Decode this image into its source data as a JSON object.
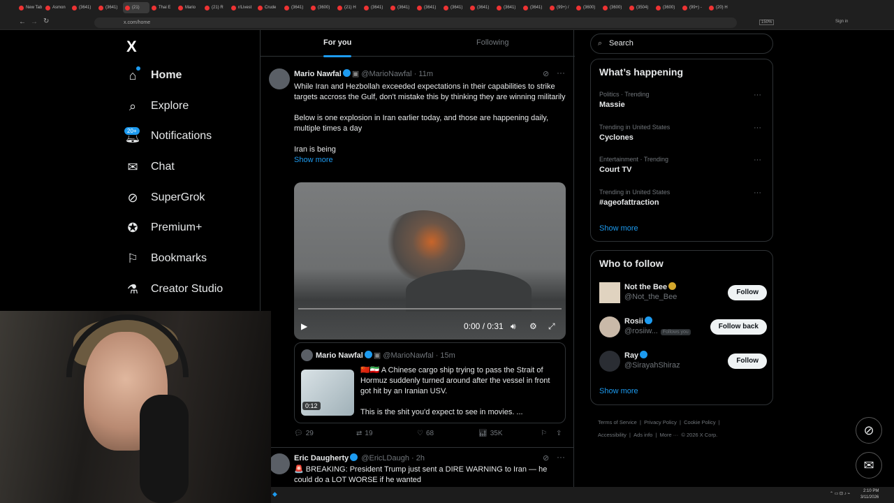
{
  "browser": {
    "tabs": [
      "New Tab",
      "Asmon",
      "(3641)",
      "(3641)",
      "(21)",
      "Thai E",
      "Mario",
      "(21) R",
      "r/Livest",
      "Crude",
      "(3641)",
      "(3600)",
      "(21) H",
      "(3641)",
      "(3641)",
      "(3641)",
      "(3641)",
      "(3641)",
      "(3641)",
      "(3641)",
      "(99+) /",
      "(3600)",
      "(3600)",
      "(3504)",
      "(3600)",
      "(99+) -",
      "(20) H"
    ],
    "url": "x.com/home",
    "zoom": "150%",
    "sign_in": "Sign in"
  },
  "nav": {
    "logo": "X",
    "notif_badge": "20+",
    "items": [
      {
        "label": "Home",
        "icon": "home-icon"
      },
      {
        "label": "Explore",
        "icon": "search-icon"
      },
      {
        "label": "Notifications",
        "icon": "bell-icon"
      },
      {
        "label": "Chat",
        "icon": "mail-icon"
      },
      {
        "label": "SuperGrok",
        "icon": "grok-icon"
      },
      {
        "label": "Premium+",
        "icon": "premium-icon"
      },
      {
        "label": "Bookmarks",
        "icon": "bookmark-icon"
      },
      {
        "label": "Creator Studio",
        "icon": "flask-icon"
      }
    ]
  },
  "feed": {
    "tabs": [
      "For you",
      "Following"
    ],
    "tweet1": {
      "name": "Mario Nawfal",
      "handle": "@MarioNawfal",
      "time": "· 11m",
      "text1": "While Iran and Hezbollah exceeded expectations in their capabilities to strike targets accross the Gulf, don't mistake this by thinking they are winning militarily",
      "text2": "Below is one explosion in Iran earlier today, and those are happening daily, multiple times a day",
      "text3": "Iran is being",
      "show_more": "Show more",
      "video_time": "0:00 / 0:31",
      "quote": {
        "name": "Mario Nawfal",
        "handle": "@MarioNawfal",
        "time": "· 15m",
        "text": "🇨🇳🇮🇷 A Chinese cargo ship trying to pass the Strait of Hormuz suddenly turned around after the vessel in front got hit by an Iranian USV.",
        "text2": "This is the shit you'd expect to see in movies. ...",
        "duration": "0:12"
      },
      "actions": {
        "replies": "29",
        "reposts": "19",
        "likes": "68",
        "views": "35K"
      }
    },
    "tweet2": {
      "name": "Eric Daugherty",
      "handle": "@EricLDaugh",
      "time": "· 2h",
      "text": "🚨 BREAKING: President Trump just sent a DIRE WARNING to Iran — he could do a LOT WORSE if he wanted"
    }
  },
  "sidebar": {
    "search_placeholder": "Search",
    "happening_title": "What’s happening",
    "trends": [
      {
        "category": "Politics · Trending",
        "name": "Massie"
      },
      {
        "category": "Trending in United States",
        "name": "Cyclones"
      },
      {
        "category": "Entertainment · Trending",
        "name": "Court TV"
      },
      {
        "category": "Trending in United States",
        "name": "#ageofattraction"
      }
    ],
    "show_more": "Show more",
    "wtf_title": "Who to follow",
    "follows": [
      {
        "name": "Not the Bee",
        "handle": "@Not_the_Bee",
        "button": "Follow",
        "follows_you": ""
      },
      {
        "name": "Rosii",
        "handle": "@rosiiw...",
        "button": "Follow back",
        "follows_you": "Follows you"
      },
      {
        "name": "Ray",
        "handle": "@SirayahShiraz",
        "button": "Follow",
        "follows_you": ""
      }
    ],
    "show_more2": "Show more",
    "footer": [
      "Terms of Service",
      "|",
      "Privacy Policy",
      "|",
      "Cookie Policy",
      "|",
      "Accessibility",
      "|",
      "Ads info",
      "|",
      "More ···",
      "© 2026 X Corp."
    ]
  },
  "taskbar": {
    "time": "2:10 PM",
    "date": "3/11/2026"
  }
}
